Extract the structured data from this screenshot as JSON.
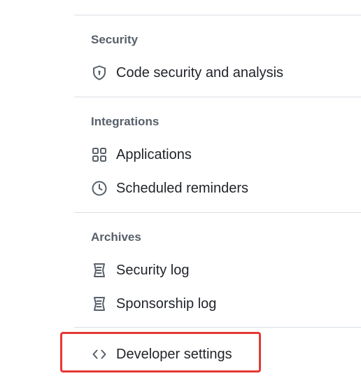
{
  "sections": {
    "security": {
      "title": "Security",
      "items": [
        {
          "label": "Code security and analysis",
          "icon": "shield-lock-icon"
        }
      ]
    },
    "integrations": {
      "title": "Integrations",
      "items": [
        {
          "label": "Applications",
          "icon": "apps-grid-icon"
        },
        {
          "label": "Scheduled reminders",
          "icon": "clock-icon"
        }
      ]
    },
    "archives": {
      "title": "Archives",
      "items": [
        {
          "label": "Security log",
          "icon": "log-icon"
        },
        {
          "label": "Sponsorship log",
          "icon": "log-icon"
        }
      ]
    },
    "developer": {
      "items": [
        {
          "label": "Developer settings",
          "icon": "code-icon"
        }
      ]
    }
  },
  "colors": {
    "text": "#1f2328",
    "muted": "#57606a",
    "divider": "#d8dee4",
    "highlight": "#e53935"
  }
}
